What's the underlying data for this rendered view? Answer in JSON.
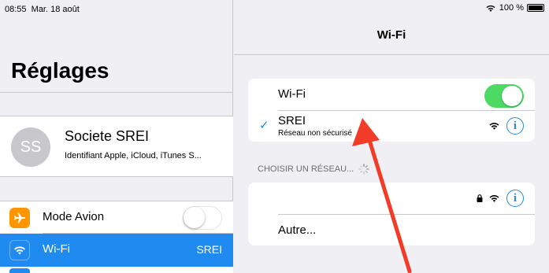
{
  "status": {
    "time": "08:55",
    "date": "Mar. 18 août",
    "battery": "100 %"
  },
  "left": {
    "title": "Réglages",
    "profile": {
      "initials": "SS",
      "name": "Societe SREI",
      "subtitle": "Identifiant Apple, iCloud, iTunes S..."
    },
    "rows": [
      {
        "label": "Mode Avion",
        "icon": "airplane-icon",
        "icon_color": "#ff9500",
        "toggle": false
      },
      {
        "label": "Wi-Fi",
        "icon": "wifi-icon",
        "icon_color": "#1f8bf0",
        "value": "SREI",
        "selected": true
      }
    ]
  },
  "right": {
    "nav_title": "Wi-Fi",
    "wifi_row": {
      "label": "Wi-Fi",
      "toggle": true
    },
    "connected": {
      "ssid": "SREI",
      "status": "Réseau non sécurisé"
    },
    "section_header": "CHOISIR UN RÉSEAU...",
    "other_label": "Autre..."
  },
  "colors": {
    "accent": "#1f8bf0",
    "toggle_on": "#4cd964",
    "airplane": "#ff9500",
    "annotation_arrow": "#f23c28"
  }
}
